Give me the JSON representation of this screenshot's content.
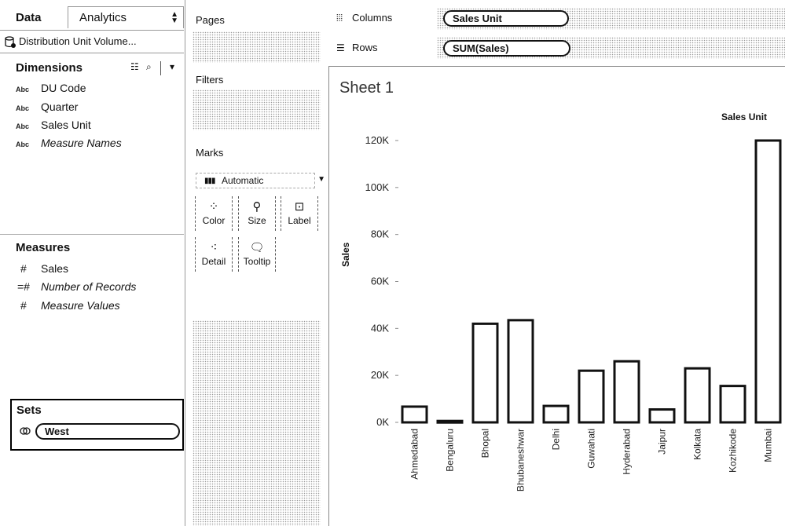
{
  "data_pane": {
    "tab_data": "Data",
    "tab_analytics": "Analytics",
    "datasource": "Distribution Unit Volume...",
    "dimensions_title": "Dimensions",
    "dimensions": [
      {
        "type": "Abc",
        "label": "DU Code",
        "italic": false
      },
      {
        "type": "Abc",
        "label": "Quarter",
        "italic": false
      },
      {
        "type": "Abc",
        "label": "Sales Unit",
        "italic": false
      },
      {
        "type": "Abc",
        "label": "Measure Names",
        "italic": true
      }
    ],
    "measures_title": "Measures",
    "measures": [
      {
        "icon": "#",
        "label": "Sales",
        "italic": false
      },
      {
        "icon": "=#",
        "label": "Number of Records",
        "italic": true
      },
      {
        "icon": "#",
        "label": "Measure Values",
        "italic": true
      }
    ],
    "sets_title": "Sets",
    "set_item": "West"
  },
  "shelves": {
    "pages": "Pages",
    "filters": "Filters",
    "marks": "Marks",
    "mark_type": "Automatic",
    "mark_buttons": [
      "Color",
      "Size",
      "Label",
      "Detail",
      "Tooltip"
    ],
    "columns_label": "Columns",
    "rows_label": "Rows",
    "columns_pill": "Sales Unit",
    "rows_pill": "SUM(Sales)"
  },
  "sheet": {
    "title": "Sheet 1"
  },
  "chart_data": {
    "type": "bar",
    "column_header": "Sales Unit",
    "ylabel": "Sales",
    "ylim": [
      0,
      120000
    ],
    "y_ticks": [
      0,
      20000,
      40000,
      60000,
      80000,
      100000,
      120000
    ],
    "y_tick_labels": [
      "0K",
      "20K",
      "40K",
      "60K",
      "80K",
      "100K",
      "120K"
    ],
    "categories": [
      "Ahmedabad",
      "Bengaluru",
      "Bhopal",
      "Bhubaneshwar",
      "Delhi",
      "Guwahati",
      "Hyderabad",
      "Jaipur",
      "Kolkata",
      "Kozhikode",
      "Mumbai"
    ],
    "values": [
      6700,
      600,
      42000,
      43500,
      7000,
      22000,
      26000,
      5500,
      23000,
      15500,
      120000
    ],
    "bar_fill": "#ffffff",
    "bar_stroke": "#111111"
  }
}
